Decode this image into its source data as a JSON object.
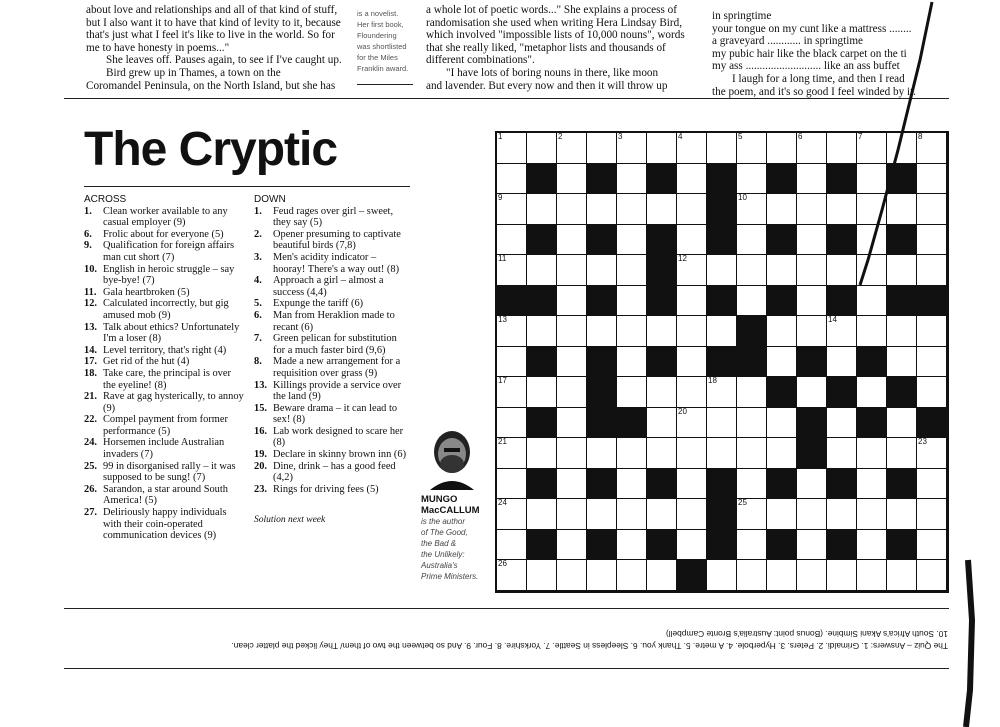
{
  "article": {
    "col1": [
      "about love and relationships and all of that kind of stuff,",
      "but I also want it to have that kind of levity to it, because",
      "that's just what I feel it's like to live in the world. So for",
      "me to have honesty in poems...\"",
      "She leaves off. Pauses again, to see if I've caught up.",
      "Bird grew up in Thames, a town on the",
      "Coromandel Peninsula, on the North Island, but she has"
    ],
    "sidebar": [
      "is a novelist.",
      "Her first book,",
      "Floundering",
      "was shortlisted",
      "for the Miles",
      "Franklin award."
    ],
    "col2": [
      "a whole lot of poetic words...\" She explains a process of",
      "randomisation she used when writing Hera Lindsay Bird,",
      "which involved \"impossible lists of 10,000 nouns\", words",
      "that she really liked, \"metaphor lists and thousands of",
      "different combinations\".",
      "\"I have lots of boring nouns in there, like moon",
      "and lavender. But every now and then it will throw up"
    ],
    "col3": [
      "in springtime",
      "your tongue on my cunt like a mattress ........",
      "a graveyard ............ in springtime",
      "my pubic hair like the black carpet on the ti",
      "my ass ........................... like an ass buffet",
      "I laugh for a long time, and then I read",
      "the poem, and it's so good I feel winded by it."
    ]
  },
  "puzzle": {
    "title": "The Cryptic",
    "across_heading": "ACROSS",
    "down_heading": "DOWN",
    "across": [
      {
        "n": "1.",
        "t": "Clean worker available to any casual employer (9)"
      },
      {
        "n": "6.",
        "t": "Frolic about for everyone (5)"
      },
      {
        "n": "9.",
        "t": "Qualification for foreign affairs man cut short (7)"
      },
      {
        "n": "10.",
        "t": "English in heroic struggle – say bye-bye! (7)"
      },
      {
        "n": "11.",
        "t": "Gala heartbroken (5)"
      },
      {
        "n": "12.",
        "t": "Calculated incorrectly, but gig amused mob (9)"
      },
      {
        "n": "13.",
        "t": "Talk about ethics? Unfortunately I'm a loser (8)"
      },
      {
        "n": "14.",
        "t": "Level territory, that's right (4)"
      },
      {
        "n": "17.",
        "t": "Get rid of the hut (4)"
      },
      {
        "n": "18.",
        "t": "Take care, the principal is over the eyeline! (8)"
      },
      {
        "n": "21.",
        "t": "Rave at gag hysterically, to annoy (9)"
      },
      {
        "n": "22.",
        "t": "Compel payment from former performance (5)"
      },
      {
        "n": "24.",
        "t": "Horsemen include Australian invaders (7)"
      },
      {
        "n": "25.",
        "t": "99 in disorganised rally – it was supposed to be sung! (7)"
      },
      {
        "n": "26.",
        "t": "Sarandon, a star around South America! (5)"
      },
      {
        "n": "27.",
        "t": "Deliriously happy individuals with their coin-operated communication devices (9)"
      }
    ],
    "down": [
      {
        "n": "1.",
        "t": "Feud rages over girl – sweet, they say (5)"
      },
      {
        "n": "2.",
        "t": "Opener presuming to captivate beautiful birds (7,8)"
      },
      {
        "n": "3.",
        "t": "Men's acidity indicator – hooray! There's a way out! (8)"
      },
      {
        "n": "4.",
        "t": "Approach a girl – almost a success (4,4)"
      },
      {
        "n": "5.",
        "t": "Expunge the tariff (6)"
      },
      {
        "n": "6.",
        "t": "Man from Heraklion made to recant (6)"
      },
      {
        "n": "7.",
        "t": "Green pelican for substitution for a much faster bird (9,6)"
      },
      {
        "n": "8.",
        "t": "Made a new arrangement for a requisition over grass (9)"
      },
      {
        "n": "13.",
        "t": "Killings provide a service over the land (9)"
      },
      {
        "n": "15.",
        "t": "Beware drama – it can lead to sex! (8)"
      },
      {
        "n": "16.",
        "t": "Lab work designed to scare her (8)"
      },
      {
        "n": "19.",
        "t": "Declare in skinny brown inn (6)"
      },
      {
        "n": "20.",
        "t": "Dine, drink – has a good feed (4,2)"
      },
      {
        "n": "23.",
        "t": "Rings for driving fees (5)"
      }
    ],
    "solution_note": "Solution next week"
  },
  "author": {
    "name_line1": "MUNGO",
    "name_line2": "MacCALLUM",
    "bio": [
      "is the author",
      "of The Good,",
      "the Bad &",
      "the Unlikely:",
      "Australia's",
      "Prime Ministers."
    ]
  },
  "footer": {
    "line1": "The Quiz – Answers: 1. Grimaldi. 2. Peters. 3. Hyperbole. 4. A metre. 5. Thank you. 6. Sleepless in Seattle. 7. Yorkshire. 8. Four. 9. And so between the two of them/ They licked the platter clean.",
    "line2": "10. South Africa's Akani Simbine. (Bonus point: Australia's Bronte Campbell)"
  },
  "grid_numbers": [
    {
      "r": 0,
      "c": 0,
      "n": "1"
    },
    {
      "r": 0,
      "c": 2,
      "n": "2"
    },
    {
      "r": 0,
      "c": 4,
      "n": "3"
    },
    {
      "r": 0,
      "c": 6,
      "n": "4"
    },
    {
      "r": 0,
      "c": 8,
      "n": "5"
    },
    {
      "r": 0,
      "c": 10,
      "n": "6"
    },
    {
      "r": 0,
      "c": 12,
      "n": "7"
    },
    {
      "r": 0,
      "c": 14,
      "n": "8"
    },
    {
      "r": 2,
      "c": 0,
      "n": "9"
    },
    {
      "r": 2,
      "c": 8,
      "n": "10"
    },
    {
      "r": 4,
      "c": 0,
      "n": "11"
    },
    {
      "r": 4,
      "c": 6,
      "n": "12"
    },
    {
      "r": 6,
      "c": 0,
      "n": "13"
    },
    {
      "r": 6,
      "c": 11,
      "n": "14"
    },
    {
      "r": 7,
      "c": 8,
      "n": "15"
    },
    {
      "r": 7,
      "c": 10,
      "n": "16"
    },
    {
      "r": 8,
      "c": 0,
      "n": "17"
    },
    {
      "r": 8,
      "c": 7,
      "n": "18"
    },
    {
      "r": 9,
      "c": 4,
      "n": "19"
    },
    {
      "r": 9,
      "c": 6,
      "n": "20"
    },
    {
      "r": 10,
      "c": 0,
      "n": "21"
    },
    {
      "r": 10,
      "c": 10,
      "n": "22"
    },
    {
      "r": 10,
      "c": 14,
      "n": "23"
    },
    {
      "r": 12,
      "c": 0,
      "n": "24"
    },
    {
      "r": 12,
      "c": 8,
      "n": "25"
    },
    {
      "r": 14,
      "c": 0,
      "n": "26"
    },
    {
      "r": 14,
      "c": 6,
      "n": "27"
    }
  ],
  "grid_pattern": [
    "...............",
    ".#.#.#.#.#.#.#.",
    ".......#.......",
    ".#.#.#.#.#.#.#.",
    ".....#.........",
    "##.#.#.#.#.#.##",
    "........#......",
    ".#.#.#.##.#.#..",
    "...#.....#.#.#.",
    ".#.##.....#.#.#",
    "..........#....",
    ".#.#.#.#.#.#.#.",
    ".......#.......",
    ".#.#.#.#.#.#.#.",
    "......#........"
  ]
}
